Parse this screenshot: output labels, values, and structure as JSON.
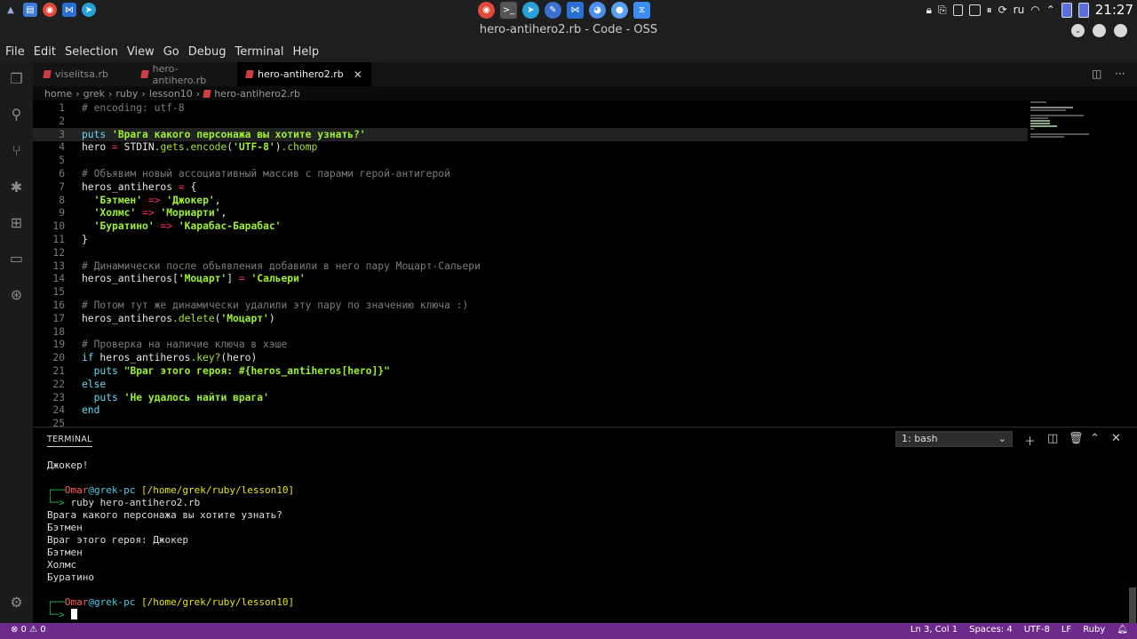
{
  "panel": {
    "tray_lang": "ru",
    "clock": "21:27"
  },
  "window": {
    "title": "hero-antihero2.rb - Code - OSS"
  },
  "menu": [
    "File",
    "Edit",
    "Selection",
    "View",
    "Go",
    "Debug",
    "Terminal",
    "Help"
  ],
  "tabs": [
    {
      "label": "viselitsa.rb",
      "active": false
    },
    {
      "label": "hero-antihero.rb",
      "active": false
    },
    {
      "label": "hero-antihero2.rb",
      "active": true
    }
  ],
  "breadcrumbs": [
    "home",
    "grek",
    "ruby",
    "lesson10",
    "hero-antihero2.rb"
  ],
  "editor": {
    "current_line": 3,
    "line_numbers": [
      "1",
      "2",
      "3",
      "4",
      "5",
      "6",
      "7",
      "8",
      "9",
      "10",
      "11",
      "12",
      "13",
      "14",
      "15",
      "16",
      "17",
      "18",
      "19",
      "20",
      "21",
      "22",
      "23",
      "24",
      "25"
    ],
    "lines": [
      "# encoding: utf-8",
      "",
      "puts 'Врага какого персонажа вы хотите узнать?'",
      "hero = STDIN.gets.encode('UTF-8').chomp",
      "",
      "# Объявим новый ассоциативный массив с парами герой-антигерой",
      "heros_antiheros = {",
      "  'Бэтмен' => 'Джокер',",
      "  'Холмс' => 'Мориарти',",
      "  'Буратино' => 'Карабас-Барабас'",
      "}",
      "",
      "# Динамически после объявления добавили в него пару Моцарт-Сальери",
      "heros_antiheros['Моцарт'] = 'Сальери'",
      "",
      "# Потом тут же динамически удалили эту пару по значению ключа :)",
      "heros_antiheros.delete('Моцарт')",
      "",
      "# Проверка на наличие ключа в хэше",
      "if heros_antiheros.key?(hero)",
      "  puts \"Враг этого героя: #{heros_antiheros[hero]}\"",
      "else",
      "  puts 'Не удалось найти врага'",
      "end",
      ""
    ]
  },
  "terminal": {
    "panel_title": "TERMINAL",
    "selector": "1: bash",
    "output_first": "Джокер!",
    "prompt_user": "Omar",
    "prompt_at": "@",
    "prompt_host": "grek-pc",
    "prompt_path": "[/home/grek/ruby/lesson10]",
    "prompt_top": "┌──",
    "prompt_bottom": "└─>",
    "command": "ruby hero-antihero2.rb",
    "output": [
      "Врага какого персонажа вы хотите узнать?",
      "Бэтмен",
      "Враг этого героя: Джокер",
      "Бэтмен",
      "Холмс",
      "Буратино"
    ]
  },
  "status": {
    "problems": "⊗ 0  ⚠ 0",
    "position": "Ln 3, Col 1",
    "spaces": "Spaces: 4",
    "encoding": "UTF-8",
    "eol": "LF",
    "language": "Ruby"
  }
}
